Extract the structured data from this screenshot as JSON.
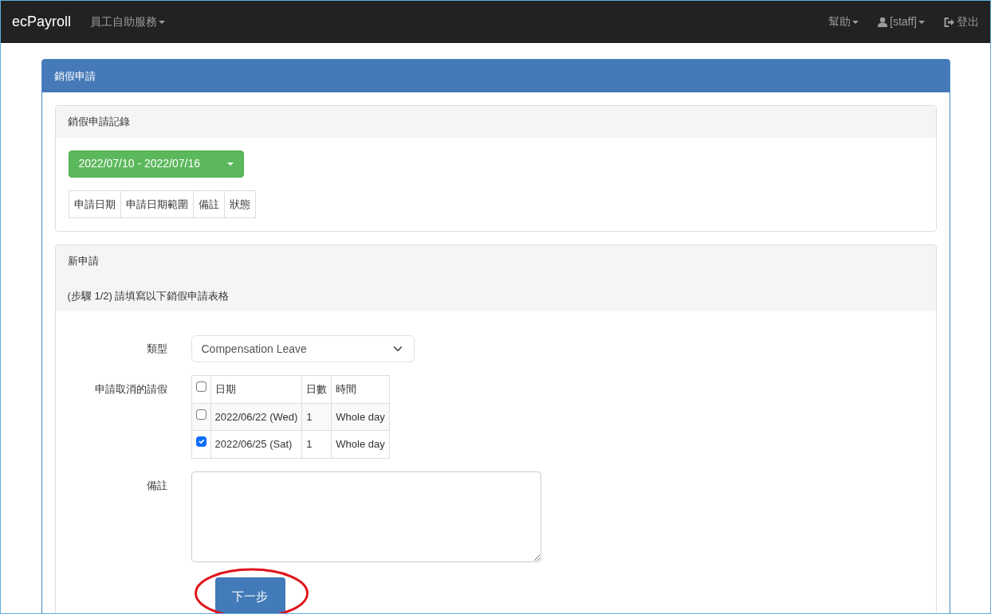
{
  "navbar": {
    "brand": "ecPayroll",
    "left_menus": [
      {
        "label": "員工自助服務",
        "dropdown": true
      }
    ],
    "right_menus": [
      {
        "kind": "plain",
        "label": "幫助",
        "dropdown": true
      },
      {
        "kind": "user",
        "label": "[staff]",
        "dropdown": true
      },
      {
        "kind": "logout",
        "label": "登出",
        "dropdown": false
      }
    ]
  },
  "panel": {
    "title": "銷假申請",
    "records": {
      "title": "銷假申請記錄",
      "date_range": "2022/07/10 - 2022/07/16",
      "columns": [
        "申請日期",
        "申請日期範圍",
        "備註",
        "狀態"
      ]
    },
    "new_request": {
      "title": "新申請",
      "instruction": "(步驟 1/2) 請填寫以下銷假申請表格",
      "type_label": "類型",
      "type_value": "Compensation Leave",
      "leave_label": "申請取消的請假",
      "leave_table": {
        "all_checked": false,
        "columns": [
          "日期",
          "日數",
          "時間"
        ],
        "rows": [
          {
            "checked": false,
            "date": "2022/06/22 (Wed)",
            "days": "1",
            "time": "Whole day"
          },
          {
            "checked": true,
            "date": "2022/06/25 (Sat)",
            "days": "1",
            "time": "Whole day"
          }
        ]
      },
      "remarks_label": "備註",
      "next_button": "下一步",
      "next_button_circled": true
    }
  }
}
